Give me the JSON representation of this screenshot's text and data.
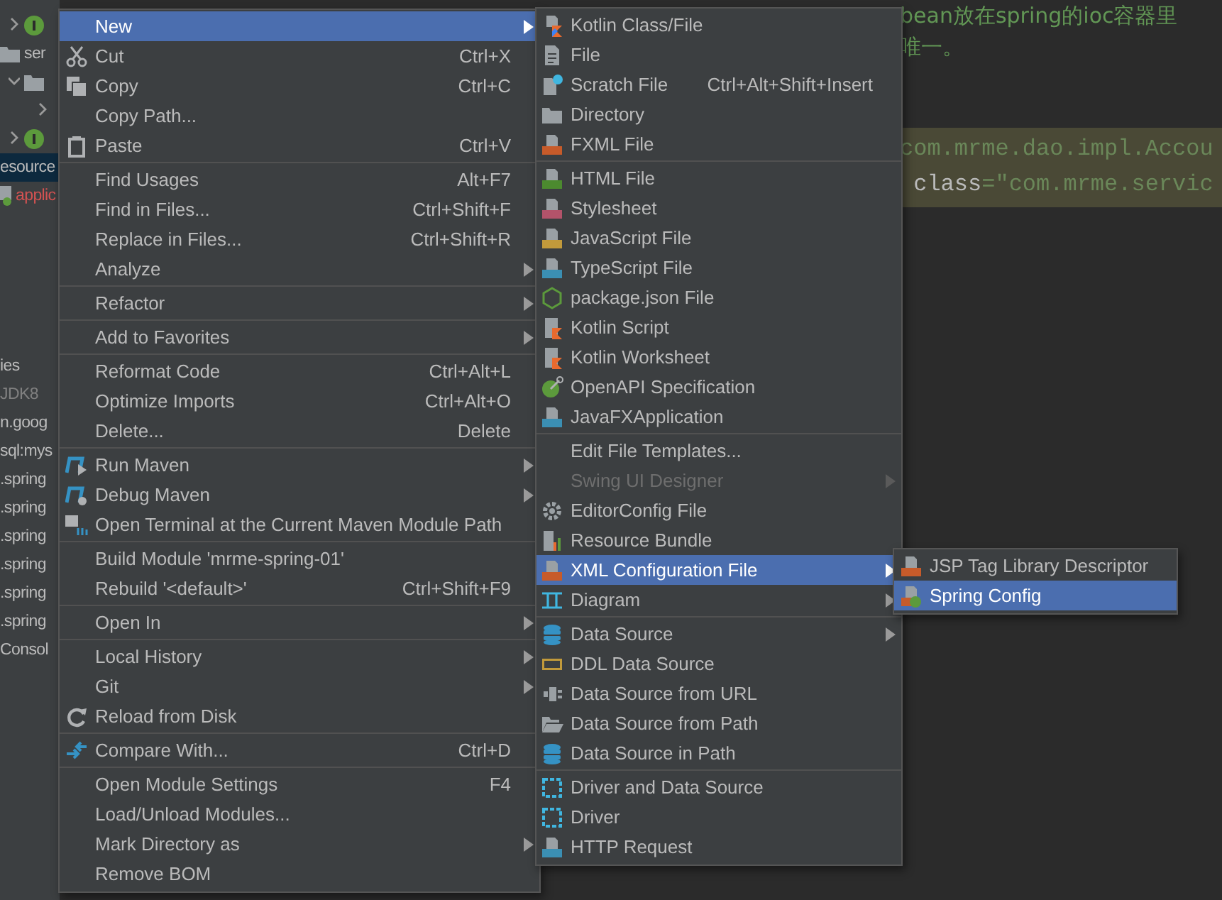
{
  "sidebar": {
    "rows": [
      {
        "kind": "interface",
        "expanded": false,
        "selected": false
      },
      {
        "kind": "folder",
        "text": "ser",
        "selected": false
      },
      {
        "kind": "folder",
        "expanded": true,
        "selected": false
      },
      {
        "kind": "plain",
        "expanded": false,
        "selected": false
      },
      {
        "kind": "interface",
        "expanded": false,
        "selected": false
      },
      {
        "kind": "plain",
        "text": "esource",
        "selected": true
      },
      {
        "kind": "error-file",
        "text": "applic",
        "selected": false
      },
      {
        "kind": "plain",
        "selected": false
      },
      {
        "kind": "plain",
        "selected": false
      },
      {
        "kind": "plain",
        "selected": false
      },
      {
        "kind": "plain",
        "selected": false
      },
      {
        "kind": "plain",
        "selected": false
      },
      {
        "kind": "plain",
        "text": "ies",
        "selected": false
      },
      {
        "kind": "muted",
        "text": "JDK8",
        "selected": false
      },
      {
        "kind": "plain",
        "text": "n.goog",
        "selected": false
      },
      {
        "kind": "plain",
        "text": "sql:mys",
        "selected": false
      },
      {
        "kind": "plain",
        "text": ".spring",
        "selected": false
      },
      {
        "kind": "plain",
        "text": ".spring",
        "selected": false
      },
      {
        "kind": "plain",
        "text": ".spring",
        "selected": false
      },
      {
        "kind": "plain",
        "text": ".spring",
        "selected": false
      },
      {
        "kind": "plain",
        "text": ".spring",
        "selected": false
      },
      {
        "kind": "plain",
        "text": ".spring",
        "selected": false
      },
      {
        "kind": "plain",
        "text": "Consol",
        "selected": false
      }
    ]
  },
  "editor": {
    "lines": [
      {
        "kind": "comment",
        "parts": [
          {
            "kind": "comment",
            "text": "bean放在spring的ioc容器里"
          }
        ]
      },
      {
        "kind": "comment",
        "parts": [
          {
            "kind": "comment",
            "text": "唯一。"
          }
        ]
      },
      {
        "kind": "code",
        "parts": [
          {
            "kind": "string",
            "text": "com.mrme.dao.impl.Accou"
          }
        ]
      },
      {
        "kind": "code",
        "parts": [
          {
            "kind": "attr",
            "text": " class"
          },
          {
            "kind": "string",
            "text": "=\"com.mrme.servic"
          }
        ]
      }
    ]
  },
  "context_menu": {
    "items": [
      {
        "kind": "item",
        "label": "New",
        "submenu": true,
        "selected": true
      },
      {
        "kind": "item",
        "label": "Cut",
        "shortcut": "Ctrl+X",
        "submenu": false,
        "selected": false
      },
      {
        "kind": "item",
        "label": "Copy",
        "shortcut": "Ctrl+C",
        "submenu": false,
        "selected": false
      },
      {
        "kind": "item",
        "label": "Copy Path...",
        "submenu": false,
        "selected": false
      },
      {
        "kind": "item",
        "label": "Paste",
        "shortcut": "Ctrl+V",
        "submenu": false,
        "selected": false
      },
      {
        "kind": "separator"
      },
      {
        "kind": "item",
        "label": "Find Usages",
        "shortcut": "Alt+F7",
        "submenu": false,
        "selected": false
      },
      {
        "kind": "item",
        "label": "Find in Files...",
        "shortcut": "Ctrl+Shift+F",
        "submenu": false,
        "selected": false
      },
      {
        "kind": "item",
        "label": "Replace in Files...",
        "shortcut": "Ctrl+Shift+R",
        "submenu": false,
        "selected": false
      },
      {
        "kind": "item",
        "label": "Analyze",
        "submenu": true,
        "selected": false
      },
      {
        "kind": "separator"
      },
      {
        "kind": "item",
        "label": "Refactor",
        "submenu": true,
        "selected": false
      },
      {
        "kind": "separator"
      },
      {
        "kind": "item",
        "label": "Add to Favorites",
        "submenu": true,
        "selected": false
      },
      {
        "kind": "separator"
      },
      {
        "kind": "item",
        "label": "Reformat Code",
        "shortcut": "Ctrl+Alt+L",
        "submenu": false,
        "selected": false
      },
      {
        "kind": "item",
        "label": "Optimize Imports",
        "shortcut": "Ctrl+Alt+O",
        "submenu": false,
        "selected": false
      },
      {
        "kind": "item",
        "label": "Delete...",
        "shortcut": "Delete",
        "submenu": false,
        "selected": false
      },
      {
        "kind": "separator"
      },
      {
        "kind": "item",
        "label": "Run Maven",
        "submenu": true,
        "selected": false
      },
      {
        "kind": "item",
        "label": "Debug Maven",
        "submenu": true,
        "selected": false
      },
      {
        "kind": "item",
        "label": "Open Terminal at the Current Maven Module Path",
        "submenu": false,
        "selected": false
      },
      {
        "kind": "separator"
      },
      {
        "kind": "item",
        "label": "Build Module 'mrme-spring-01'",
        "submenu": false,
        "selected": false
      },
      {
        "kind": "item",
        "label": "Rebuild '<default>'",
        "shortcut": "Ctrl+Shift+F9",
        "submenu": false,
        "selected": false
      },
      {
        "kind": "separator"
      },
      {
        "kind": "item",
        "label": "Open In",
        "submenu": true,
        "selected": false
      },
      {
        "kind": "separator"
      },
      {
        "kind": "item",
        "label": "Local History",
        "submenu": true,
        "selected": false
      },
      {
        "kind": "item",
        "label": "Git",
        "submenu": true,
        "selected": false
      },
      {
        "kind": "item",
        "label": "Reload from Disk",
        "submenu": false,
        "selected": false
      },
      {
        "kind": "separator"
      },
      {
        "kind": "item",
        "label": "Compare With...",
        "shortcut": "Ctrl+D",
        "submenu": false,
        "selected": false
      },
      {
        "kind": "separator"
      },
      {
        "kind": "item",
        "label": "Open Module Settings",
        "shortcut": "F4",
        "submenu": false,
        "selected": false
      },
      {
        "kind": "item",
        "label": "Load/Unload Modules...",
        "submenu": false,
        "selected": false
      },
      {
        "kind": "item",
        "label": "Mark Directory as",
        "submenu": true,
        "selected": false
      },
      {
        "kind": "item",
        "label": "Remove BOM",
        "submenu": false,
        "selected": false
      }
    ]
  },
  "new_submenu": {
    "items": [
      {
        "kind": "item",
        "label": "Kotlin Class/File",
        "submenu": false,
        "selected": false,
        "disabled": false
      },
      {
        "kind": "item",
        "label": "File",
        "submenu": false,
        "selected": false,
        "disabled": false
      },
      {
        "kind": "item",
        "label": "Scratch File",
        "shortcut": "Ctrl+Alt+Shift+Insert",
        "submenu": false,
        "selected": false,
        "disabled": false
      },
      {
        "kind": "item",
        "label": "Directory",
        "submenu": false,
        "selected": false,
        "disabled": false
      },
      {
        "kind": "item",
        "label": "FXML File",
        "submenu": false,
        "selected": false,
        "disabled": false
      },
      {
        "kind": "separator"
      },
      {
        "kind": "item",
        "label": "HTML File",
        "submenu": false,
        "selected": false,
        "disabled": false
      },
      {
        "kind": "item",
        "label": "Stylesheet",
        "submenu": false,
        "selected": false,
        "disabled": false
      },
      {
        "kind": "item",
        "label": "JavaScript File",
        "submenu": false,
        "selected": false,
        "disabled": false
      },
      {
        "kind": "item",
        "label": "TypeScript File",
        "submenu": false,
        "selected": false,
        "disabled": false
      },
      {
        "kind": "item",
        "label": "package.json File",
        "submenu": false,
        "selected": false,
        "disabled": false
      },
      {
        "kind": "item",
        "label": "Kotlin Script",
        "submenu": false,
        "selected": false,
        "disabled": false
      },
      {
        "kind": "item",
        "label": "Kotlin Worksheet",
        "submenu": false,
        "selected": false,
        "disabled": false
      },
      {
        "kind": "item",
        "label": "OpenAPI Specification",
        "submenu": false,
        "selected": false,
        "disabled": false
      },
      {
        "kind": "item",
        "label": "JavaFXApplication",
        "submenu": false,
        "selected": false,
        "disabled": false
      },
      {
        "kind": "separator"
      },
      {
        "kind": "item",
        "label": "Edit File Templates...",
        "submenu": false,
        "selected": false,
        "disabled": false
      },
      {
        "kind": "item",
        "label": "Swing UI Designer",
        "submenu": true,
        "selected": false,
        "disabled": true
      },
      {
        "kind": "item",
        "label": "EditorConfig File",
        "submenu": false,
        "selected": false,
        "disabled": false
      },
      {
        "kind": "item",
        "label": "Resource Bundle",
        "submenu": false,
        "selected": false,
        "disabled": false
      },
      {
        "kind": "item",
        "label": "XML Configuration File",
        "submenu": true,
        "selected": true,
        "disabled": false
      },
      {
        "kind": "item",
        "label": "Diagram",
        "submenu": true,
        "selected": false,
        "disabled": false
      },
      {
        "kind": "separator"
      },
      {
        "kind": "item",
        "label": "Data Source",
        "submenu": true,
        "selected": false,
        "disabled": false
      },
      {
        "kind": "item",
        "label": "DDL Data Source",
        "submenu": false,
        "selected": false,
        "disabled": false
      },
      {
        "kind": "item",
        "label": "Data Source from URL",
        "submenu": false,
        "selected": false,
        "disabled": false
      },
      {
        "kind": "item",
        "label": "Data Source from Path",
        "submenu": false,
        "selected": false,
        "disabled": false
      },
      {
        "kind": "item",
        "label": "Data Source in Path",
        "submenu": false,
        "selected": false,
        "disabled": false
      },
      {
        "kind": "separator"
      },
      {
        "kind": "item",
        "label": "Driver and Data Source",
        "submenu": false,
        "selected": false,
        "disabled": false
      },
      {
        "kind": "item",
        "label": "Driver",
        "submenu": false,
        "selected": false,
        "disabled": false
      },
      {
        "kind": "item",
        "label": "HTTP Request",
        "submenu": false,
        "selected": false,
        "disabled": false
      }
    ]
  },
  "xml_submenu": {
    "items": [
      {
        "kind": "item",
        "label": "JSP Tag Library Descriptor",
        "submenu": false,
        "selected": false
      },
      {
        "kind": "item",
        "label": "Spring Config",
        "submenu": false,
        "selected": true
      }
    ]
  }
}
